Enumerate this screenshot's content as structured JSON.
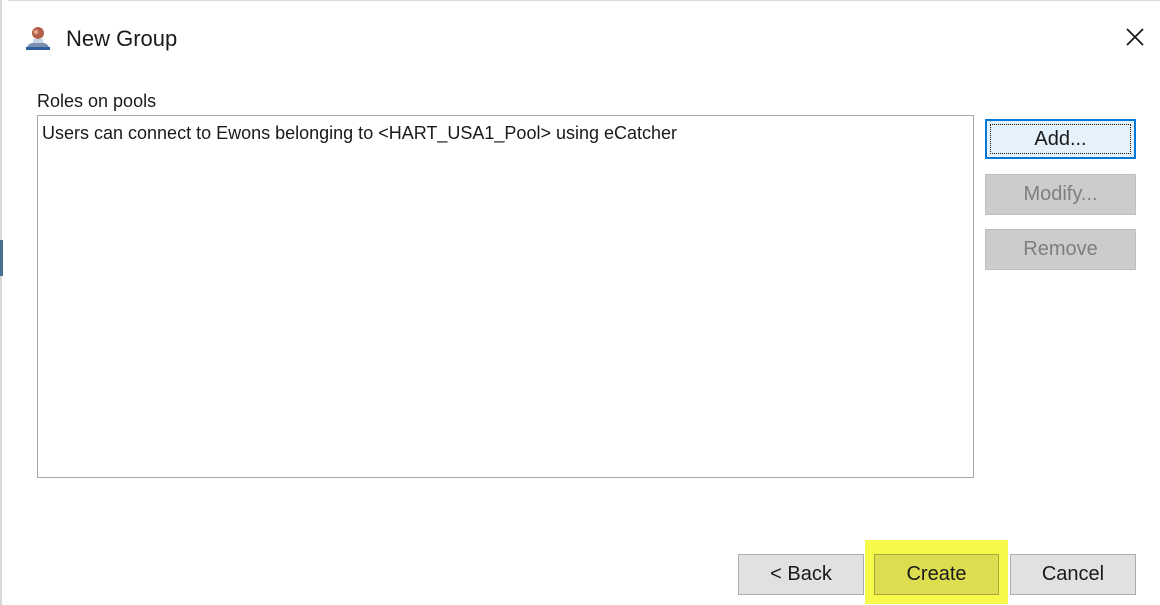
{
  "window": {
    "title": "New Group",
    "icon": "group-user-icon",
    "close_icon": "close-icon"
  },
  "roles": {
    "label": "Roles on pools",
    "items": [
      "Users can connect to Ewons belonging to <HART_USA1_Pool> using eCatcher"
    ]
  },
  "side_buttons": {
    "add": "Add...",
    "modify": "Modify...",
    "remove": "Remove"
  },
  "footer_buttons": {
    "back": "< Back",
    "create": "Create",
    "cancel": "Cancel"
  },
  "colors": {
    "highlight": "#f6f94a",
    "default_button_border": "#0078d7",
    "disabled_button_text": "#7f7f7f"
  }
}
